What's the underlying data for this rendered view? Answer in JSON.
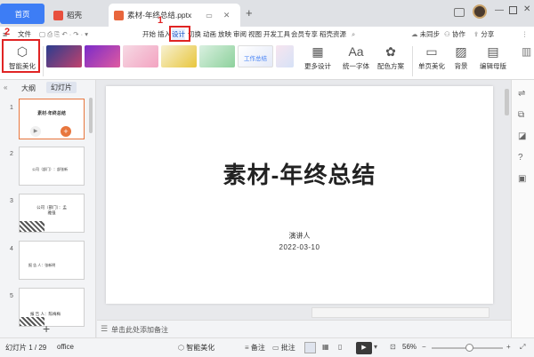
{
  "tabs": {
    "home": "首页",
    "draft": "稻壳",
    "file": "素材-年终总结.pptx",
    "new": "+"
  },
  "menu": {
    "file": "文件",
    "items": [
      "开始",
      "插入",
      "设计",
      "切换",
      "动画",
      "放映",
      "审阅",
      "视图",
      "开发工具",
      "会员专享",
      "稻壳资源"
    ],
    "sync": "未同步",
    "collab": "协作",
    "share": "分享"
  },
  "ribbon": {
    "smart_beautify": "智能美化",
    "more_design": "更多设计",
    "unify_font_icon": "Aa",
    "unify_font": "统一字体",
    "color_scheme": "配色方案",
    "single_page": "单页美化",
    "background": "背景",
    "edit_master": "编辑母版",
    "theme_caption": "工作总结"
  },
  "annotations": {
    "label1": "1",
    "label2": "2"
  },
  "leftpanel": {
    "outline_tab": "大纲",
    "slides_tab": "幻灯片",
    "slides": [
      {
        "num": "1",
        "title": "素材-年终总结"
      },
      {
        "num": "2",
        "title": "公司（部门）：部张新"
      },
      {
        "num": "3",
        "title": "公司（部门）：孟雅强"
      },
      {
        "num": "4",
        "title": "报 告 人：张新明"
      },
      {
        "num": "5",
        "title": "报 告 人：陈梅梅"
      }
    ],
    "add": "+"
  },
  "slide": {
    "title": "素材-年终总结",
    "presenter": "演讲人",
    "date": "2022-03-10"
  },
  "notes": {
    "placeholder": "单击此处添加备注"
  },
  "status": {
    "slide_count": "幻灯片 1 / 29",
    "theme": "office",
    "smart_beautify": "智能美化",
    "notes": "备注",
    "comments": "批注",
    "zoom": "56%",
    "zoom_value": 0.56
  },
  "colors": {
    "accent": "#3d7df5",
    "annotation_red": "#e02424",
    "tab_active": "#ffffff"
  }
}
